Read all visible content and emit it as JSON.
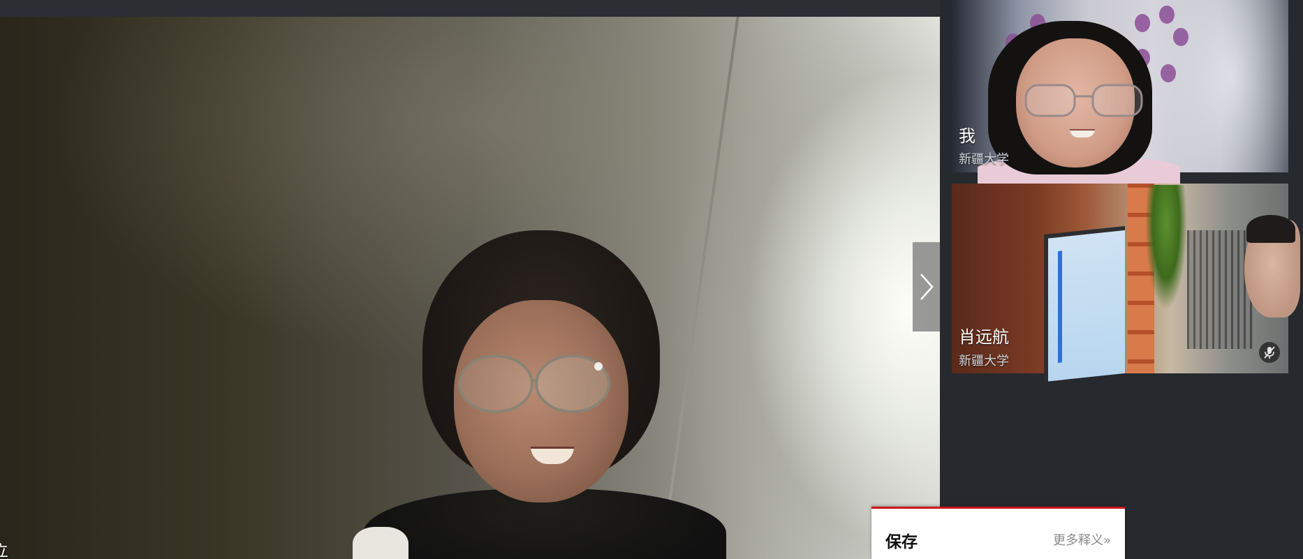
{
  "main_stage": {
    "speaker_name_partial": "立"
  },
  "navigation": {
    "next_arrow_icon": "chevron-right-icon"
  },
  "participants": [
    {
      "name": "我",
      "organization": "新疆大学",
      "muted": false
    },
    {
      "name": "肖远航",
      "organization": "新疆大学",
      "muted": true,
      "mute_icon": "mic-off-icon"
    }
  ],
  "dictionary_popup": {
    "word": "保存",
    "more_label": "更多释义»",
    "accent_color": "#d0161c"
  },
  "colors": {
    "panel_background": "#26292e",
    "top_bar": "#2b2e33"
  }
}
